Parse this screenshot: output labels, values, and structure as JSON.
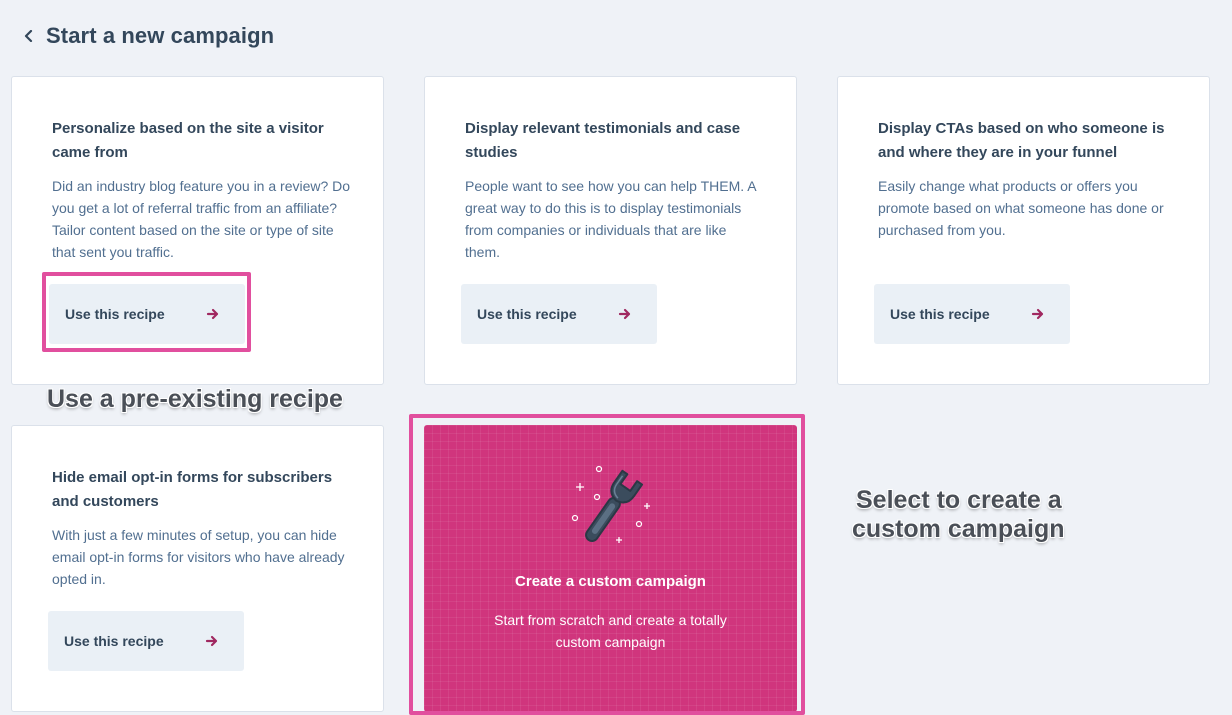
{
  "header": {
    "title": "Start a new campaign"
  },
  "recipes": [
    {
      "title": "Personalize based on the site a visitor came from",
      "description": "Did an industry blog feature you in a review? Do you get a lot of referral traffic from an affiliate? Tailor content based on the site or type of site that sent you traffic.",
      "button_label": "Use this recipe"
    },
    {
      "title": "Display relevant testimonials and case studies",
      "description": "People want to see how you can help THEM. A great way to do this is to display testimonials from companies or individuals that are like them.",
      "button_label": "Use this recipe"
    },
    {
      "title": "Display CTAs based on who someone is and where they are in your funnel",
      "description": "Easily change what products or offers you promote based on what someone has done or purchased from you.",
      "button_label": "Use this recipe"
    },
    {
      "title": "Hide email opt-in forms for subscribers and customers",
      "description": "With just a few minutes of setup, you can hide email opt-in forms for visitors who have already opted in.",
      "button_label": "Use this recipe"
    }
  ],
  "custom_campaign": {
    "title": "Create a custom campaign",
    "description": "Start from scratch and create a totally custom campaign",
    "icon": "wrench-icon"
  },
  "annotations": {
    "recipe_note": "Use a pre-existing recipe",
    "custom_note_line1": "Select to create a",
    "custom_note_line2": "custom campaign"
  },
  "colors": {
    "background": "#eff2f7",
    "accent": "#d0357d",
    "highlight": "#e14f9e",
    "arrow": "#a02860",
    "text": "#33475b"
  }
}
